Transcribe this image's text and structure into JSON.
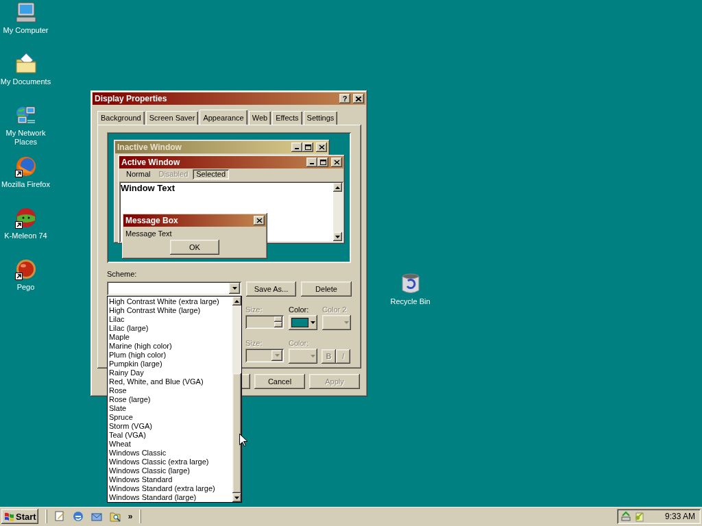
{
  "desktop_icons": [
    {
      "label": "My Computer",
      "kind": "computer",
      "shortcut": false
    },
    {
      "label": "My Documents",
      "kind": "documents",
      "shortcut": false
    },
    {
      "label": "My Network Places",
      "kind": "network",
      "shortcut": false
    },
    {
      "label": "Mozilla Firefox",
      "kind": "firefox",
      "shortcut": true
    },
    {
      "label": "K-Meleon 74",
      "kind": "kmeleon",
      "shortcut": true
    },
    {
      "label": "Pego",
      "kind": "pego",
      "shortcut": true
    }
  ],
  "recycle_bin": {
    "label": "Recycle Bin"
  },
  "window": {
    "title": "Display Properties",
    "help": "?"
  },
  "tabs": [
    {
      "label": "Background",
      "selected": false
    },
    {
      "label": "Screen Saver",
      "selected": false
    },
    {
      "label": "Appearance",
      "selected": true
    },
    {
      "label": "Web",
      "selected": false
    },
    {
      "label": "Effects",
      "selected": false
    },
    {
      "label": "Settings",
      "selected": false
    }
  ],
  "preview": {
    "inactive_title": "Inactive Window",
    "active_title": "Active Window",
    "menu": [
      {
        "label": "Normal",
        "disabled": false,
        "selected": false
      },
      {
        "label": "Disabled",
        "disabled": true,
        "selected": false
      },
      {
        "label": "Selected",
        "disabled": false,
        "selected": true
      }
    ],
    "window_text": "Window Text",
    "message_box": {
      "title": "Message Box",
      "text": "Message Text",
      "button": "OK"
    }
  },
  "scheme": {
    "label": "Scheme:",
    "buttons": [
      "Save As...",
      "Delete"
    ],
    "options": [
      {
        "label": "High Contrast White (extra large)",
        "selected": false
      },
      {
        "label": "High Contrast White (large)",
        "selected": false
      },
      {
        "label": "Lilac",
        "selected": false
      },
      {
        "label": "Lilac (large)",
        "selected": false
      },
      {
        "label": "Maple",
        "selected": false
      },
      {
        "label": "Marine (high color)",
        "selected": false
      },
      {
        "label": "Plum (high color)",
        "selected": false
      },
      {
        "label": "Pumpkin (large)",
        "selected": false
      },
      {
        "label": "Rainy Day",
        "selected": false
      },
      {
        "label": "Red, White, and Blue (VGA)",
        "selected": false
      },
      {
        "label": "Rose",
        "selected": false
      },
      {
        "label": "Rose (large)",
        "selected": false
      },
      {
        "label": "Slate",
        "selected": false
      },
      {
        "label": "Spruce",
        "selected": false
      },
      {
        "label": "Storm (VGA)",
        "selected": false
      },
      {
        "label": "Teal (VGA)",
        "selected": false
      },
      {
        "label": "Wheat",
        "selected": false
      },
      {
        "label": "Windows Classic",
        "selected": false
      },
      {
        "label": "Windows Classic (extra large)",
        "selected": false
      },
      {
        "label": "Windows Classic (large)",
        "selected": false
      },
      {
        "label": "Windows Standard",
        "selected": false
      },
      {
        "label": "Windows Standard (extra large)",
        "selected": false
      },
      {
        "label": "Windows Standard (large)",
        "selected": false
      }
    ]
  },
  "item_row": [
    {
      "label": "Size:",
      "kind": "spin",
      "disabled": true
    },
    {
      "label": "Color:",
      "kind": "color",
      "disabled": false,
      "color": "#008080"
    },
    {
      "label": "Color 2",
      "kind": "color",
      "disabled": true
    }
  ],
  "font_row": [
    {
      "label": "Size:",
      "kind": "combo",
      "disabled": true
    },
    {
      "label": "Color:",
      "kind": "color",
      "disabled": true
    }
  ],
  "font_styles": [
    {
      "label": "B",
      "disabled": true
    },
    {
      "label": "I",
      "disabled": true
    }
  ],
  "dialog_buttons": [
    {
      "label": "Cancel",
      "disabled": false
    },
    {
      "label": "Apply",
      "disabled": true
    }
  ],
  "taskbar": {
    "start": "Start",
    "more": "»",
    "clock": "9:33 AM"
  }
}
